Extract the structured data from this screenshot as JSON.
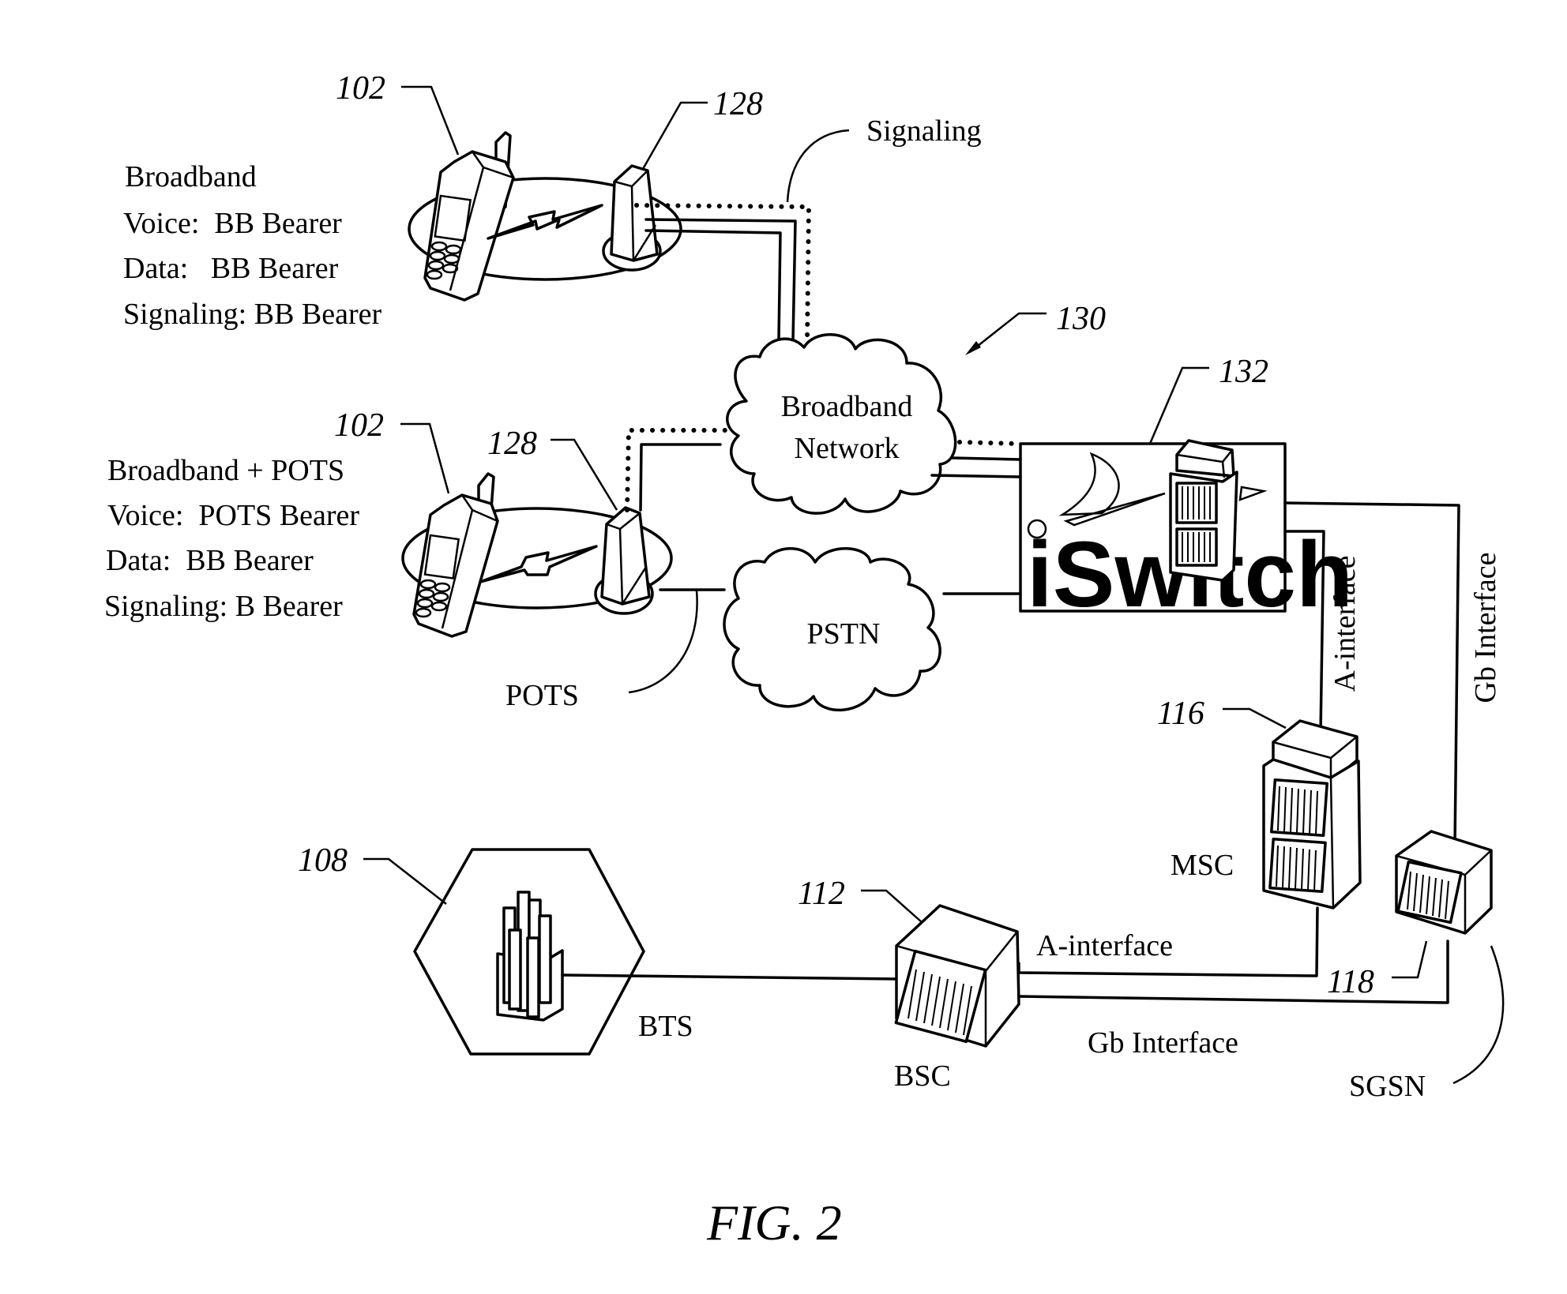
{
  "figure": {
    "caption": "FIG. 2",
    "colors": {
      "ink": "#000000",
      "background": "#ffffff"
    }
  },
  "top_site": {
    "phone_ref": "102",
    "tower_ref": "128",
    "signaling_label": "Signaling",
    "description": [
      "Broadband",
      "Voice:  BB Bearer",
      "Data:   BB Bearer",
      "Signaling: BB Bearer"
    ]
  },
  "bottom_site": {
    "phone_ref": "102",
    "tower_ref": "128",
    "pots_label": "POTS",
    "description": [
      "Broadband + POTS",
      "Voice:  POTS Bearer",
      "Data:  BB Bearer",
      "Signaling: B Bearer"
    ]
  },
  "network": {
    "ref": "130",
    "broadband_cloud": [
      "Broadband",
      "Network"
    ],
    "pstn_cloud": "PSTN"
  },
  "iswitch": {
    "ref": "132",
    "logo_text": "iSwitch"
  },
  "gsm": {
    "bts": {
      "ref": "108",
      "label": "BTS"
    },
    "bsc": {
      "ref": "112",
      "label": "BSC"
    },
    "msc": {
      "ref": "116",
      "label": "MSC"
    },
    "sgsn": {
      "ref": "118",
      "label": "SGSN"
    },
    "links": {
      "iswitch_msc": "A-interface",
      "iswitch_sgsn": "Gb Interface",
      "bsc_msc": "A-interface",
      "bsc_sgsn": "Gb Interface"
    }
  }
}
